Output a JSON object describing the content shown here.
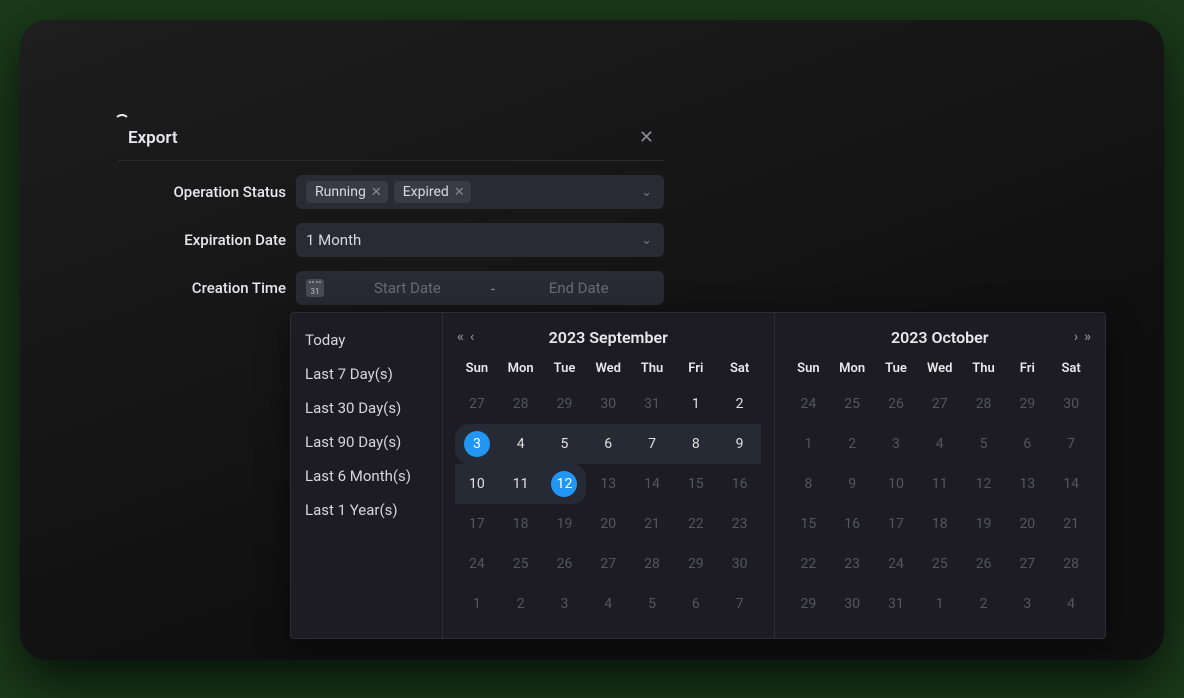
{
  "dialog": {
    "title": "Export",
    "closeGlyph": "✕",
    "fields": {
      "status": {
        "label": "Operation Status",
        "tags": [
          "Running",
          "Expired"
        ]
      },
      "expiration": {
        "label": "Expiration Date",
        "value": "1 Month"
      },
      "creation": {
        "label": "Creation Time",
        "startPlaceholder": "Start Date",
        "endPlaceholder": "End Date",
        "separator": "-",
        "iconText": "31"
      }
    }
  },
  "datepicker": {
    "presets": [
      "Today",
      "Last 7 Day(s)",
      "Last 30 Day(s)",
      "Last 90 Day(s)",
      "Last 6 Month(s)",
      "Last 1 Year(s)"
    ],
    "dow": [
      "Sun",
      "Mon",
      "Tue",
      "Wed",
      "Thu",
      "Fri",
      "Sat"
    ],
    "nav": {
      "dprev": "«",
      "prev": "‹",
      "next": "›",
      "dnext": "»"
    },
    "left": {
      "title": "2023 September",
      "selStart": 3,
      "selEnd": 12,
      "days": [
        {
          "n": 27,
          "out": true
        },
        {
          "n": 28,
          "out": true
        },
        {
          "n": 29,
          "out": true
        },
        {
          "n": 30,
          "out": true
        },
        {
          "n": 31,
          "out": true
        },
        {
          "n": 1
        },
        {
          "n": 2
        },
        {
          "n": 3
        },
        {
          "n": 4
        },
        {
          "n": 5
        },
        {
          "n": 6
        },
        {
          "n": 7
        },
        {
          "n": 8
        },
        {
          "n": 9
        },
        {
          "n": 10
        },
        {
          "n": 11
        },
        {
          "n": 12
        },
        {
          "n": 13,
          "disabled": true
        },
        {
          "n": 14,
          "disabled": true
        },
        {
          "n": 15,
          "disabled": true
        },
        {
          "n": 16,
          "disabled": true
        },
        {
          "n": 17,
          "disabled": true
        },
        {
          "n": 18,
          "disabled": true
        },
        {
          "n": 19,
          "disabled": true
        },
        {
          "n": 20,
          "disabled": true
        },
        {
          "n": 21,
          "disabled": true
        },
        {
          "n": 22,
          "disabled": true
        },
        {
          "n": 23,
          "disabled": true
        },
        {
          "n": 24,
          "disabled": true
        },
        {
          "n": 25,
          "disabled": true
        },
        {
          "n": 26,
          "disabled": true
        },
        {
          "n": 27,
          "disabled": true
        },
        {
          "n": 28,
          "disabled": true
        },
        {
          "n": 29,
          "disabled": true
        },
        {
          "n": 30,
          "disabled": true
        },
        {
          "n": 1,
          "out": true
        },
        {
          "n": 2,
          "out": true
        },
        {
          "n": 3,
          "out": true
        },
        {
          "n": 4,
          "out": true
        },
        {
          "n": 5,
          "out": true
        },
        {
          "n": 6,
          "out": true
        },
        {
          "n": 7,
          "out": true
        }
      ]
    },
    "right": {
      "title": "2023 October",
      "days": [
        {
          "n": 24,
          "out": true
        },
        {
          "n": 25,
          "out": true
        },
        {
          "n": 26,
          "out": true
        },
        {
          "n": 27,
          "out": true
        },
        {
          "n": 28,
          "out": true
        },
        {
          "n": 29,
          "out": true
        },
        {
          "n": 30,
          "out": true
        },
        {
          "n": 1,
          "disabled": true
        },
        {
          "n": 2,
          "disabled": true
        },
        {
          "n": 3,
          "disabled": true
        },
        {
          "n": 4,
          "disabled": true
        },
        {
          "n": 5,
          "disabled": true
        },
        {
          "n": 6,
          "disabled": true
        },
        {
          "n": 7,
          "disabled": true
        },
        {
          "n": 8,
          "disabled": true
        },
        {
          "n": 9,
          "disabled": true
        },
        {
          "n": 10,
          "disabled": true
        },
        {
          "n": 11,
          "disabled": true
        },
        {
          "n": 12,
          "disabled": true
        },
        {
          "n": 13,
          "disabled": true
        },
        {
          "n": 14,
          "disabled": true
        },
        {
          "n": 15,
          "disabled": true
        },
        {
          "n": 16,
          "disabled": true
        },
        {
          "n": 17,
          "disabled": true
        },
        {
          "n": 18,
          "disabled": true
        },
        {
          "n": 19,
          "disabled": true
        },
        {
          "n": 20,
          "disabled": true
        },
        {
          "n": 21,
          "disabled": true
        },
        {
          "n": 22,
          "disabled": true
        },
        {
          "n": 23,
          "disabled": true
        },
        {
          "n": 24,
          "disabled": true
        },
        {
          "n": 25,
          "disabled": true
        },
        {
          "n": 26,
          "disabled": true
        },
        {
          "n": 27,
          "disabled": true
        },
        {
          "n": 28,
          "disabled": true
        },
        {
          "n": 29,
          "disabled": true
        },
        {
          "n": 30,
          "disabled": true
        },
        {
          "n": 31,
          "disabled": true
        },
        {
          "n": 1,
          "out": true
        },
        {
          "n": 2,
          "out": true
        },
        {
          "n": 3,
          "out": true
        },
        {
          "n": 4,
          "out": true
        }
      ]
    }
  }
}
